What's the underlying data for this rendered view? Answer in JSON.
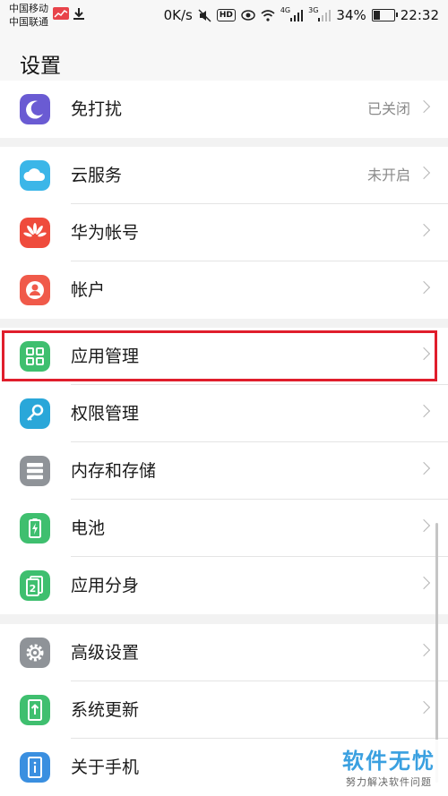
{
  "status": {
    "carrier1": "中国移动",
    "carrier2": "中国联通",
    "speed": "0K/s",
    "hd": "HD",
    "net1": "4G",
    "net2": "3G",
    "battery_percent": "34%",
    "battery_level": 0.34,
    "time": "22:32"
  },
  "header": {
    "title": "设置"
  },
  "groups": [
    {
      "items": [
        {
          "label": "免打扰",
          "value": "已关闭",
          "icon": "moon-icon",
          "color": "#6a5bd3"
        }
      ]
    },
    {
      "items": [
        {
          "label": "云服务",
          "value": "未开启",
          "icon": "cloud-icon",
          "color": "#3bb6e8"
        },
        {
          "label": "华为帐号",
          "icon": "huawei-logo-icon",
          "color": "#ef4b3c"
        },
        {
          "label": "帐户",
          "icon": "account-icon",
          "color": "#f05a4a"
        }
      ]
    },
    {
      "items": [
        {
          "label": "应用管理",
          "icon": "apps-grid-icon",
          "color": "#3fbf6f"
        },
        {
          "label": "权限管理",
          "icon": "key-icon",
          "color": "#2aa7d9"
        },
        {
          "label": "内存和存储",
          "icon": "storage-icon",
          "color": "#8f9398"
        },
        {
          "label": "电池",
          "icon": "battery-icon",
          "color": "#3fbf6f"
        },
        {
          "label": "应用分身",
          "icon": "app-twin-icon",
          "color": "#3fbf6f"
        }
      ]
    },
    {
      "items": [
        {
          "label": "高级设置",
          "icon": "gear-icon",
          "color": "#8f9398"
        },
        {
          "label": "系统更新",
          "icon": "system-update-icon",
          "color": "#3fbf6f"
        },
        {
          "label": "关于手机",
          "icon": "phone-info-icon",
          "color": "#3a8fe0"
        }
      ]
    }
  ],
  "watermark": {
    "main": "软件无忧",
    "sub": "努力解决软件问题"
  }
}
